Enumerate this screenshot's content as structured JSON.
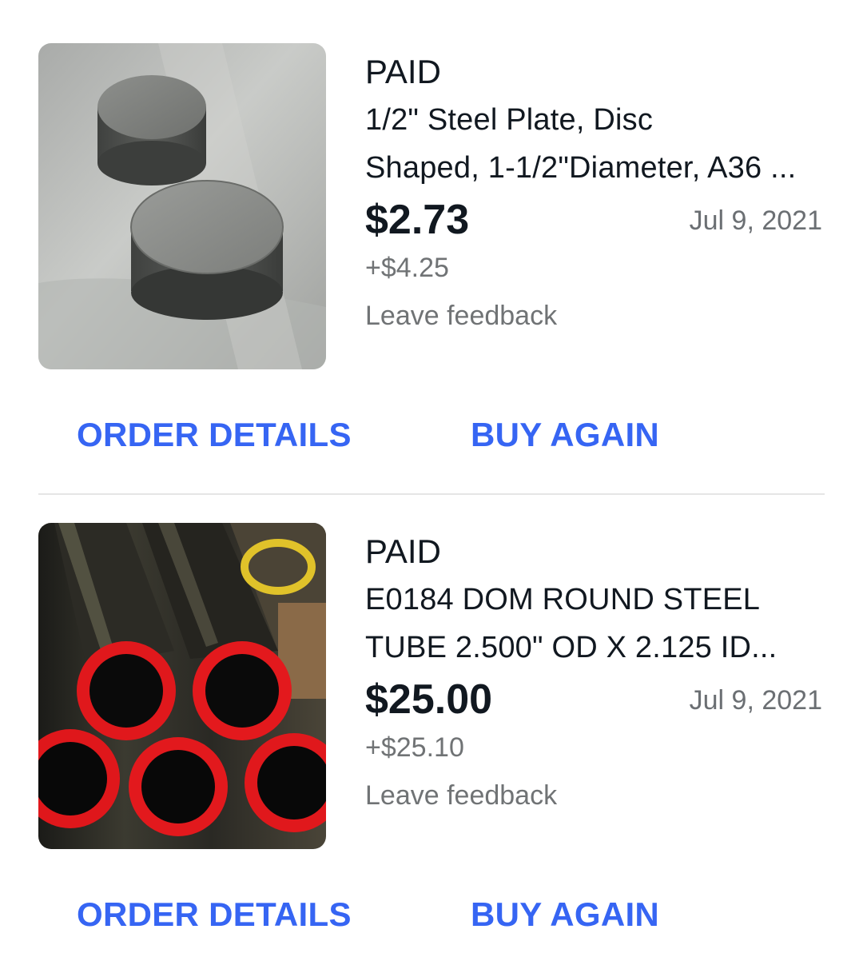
{
  "orders": [
    {
      "status": "PAID",
      "title_line1": "1/2\" Steel Plate, Disc",
      "title_line2": "Shaped, 1-1/2\"Diameter, A36 ...",
      "price": "$2.73",
      "date": "Jul 9, 2021",
      "shipping": "+$4.25",
      "feedback_label": "Leave feedback",
      "order_details_label": "ORDER DETAILS",
      "buy_again_label": "BUY AGAIN",
      "image_alt": "steel-disc-photo"
    },
    {
      "status": "PAID",
      "title_line1": "E0184 DOM ROUND STEEL",
      "title_line2": "TUBE  2.500\" OD  X  2.125  ID...",
      "price": "$25.00",
      "date": "Jul 9, 2021",
      "shipping": "+$25.10",
      "feedback_label": "Leave feedback",
      "order_details_label": "ORDER DETAILS",
      "buy_again_label": "BUY AGAIN",
      "image_alt": "steel-tube-photo"
    }
  ],
  "colors": {
    "link_blue": "#3665f3",
    "text_primary": "#111820",
    "text_secondary": "#707375",
    "divider": "#e5e5e5"
  }
}
